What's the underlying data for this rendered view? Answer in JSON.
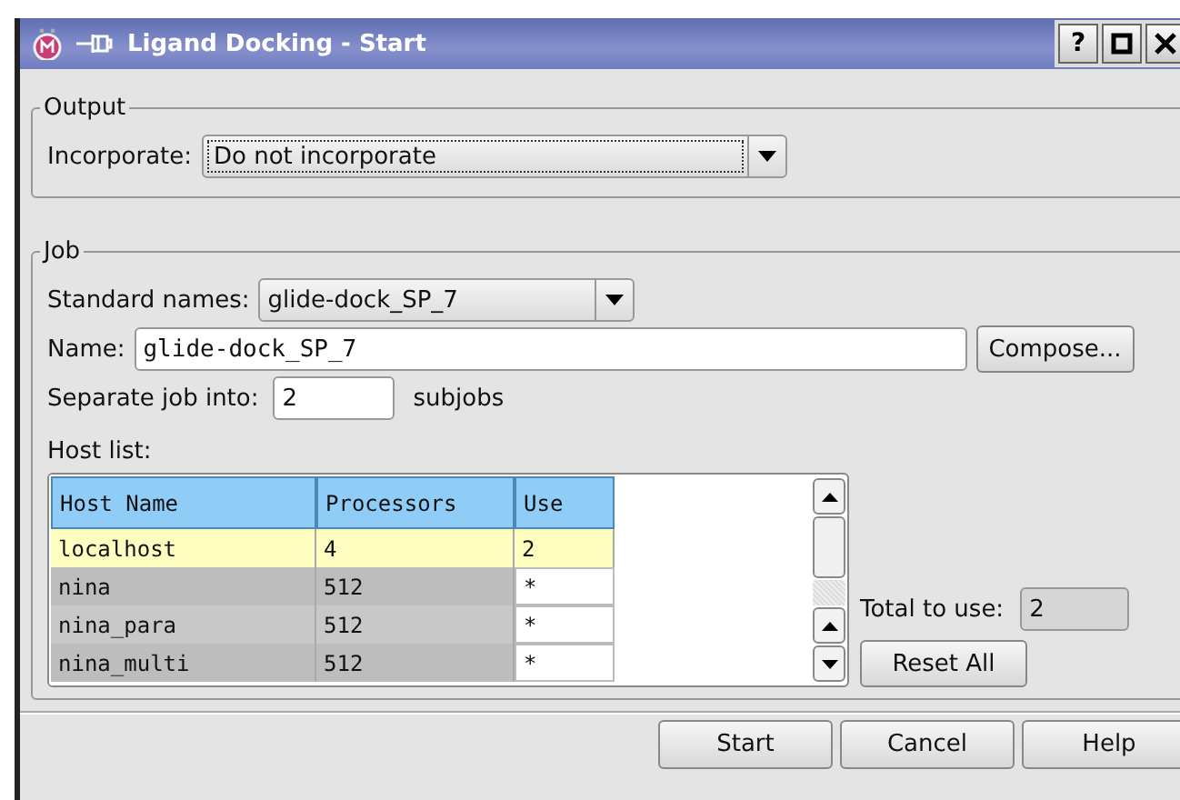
{
  "window": {
    "title": "Ligand Docking - Start",
    "help_button": "?"
  },
  "output": {
    "legend": "Output",
    "incorporate": {
      "label": "Incorporate:",
      "value": "Do not incorporate"
    }
  },
  "job": {
    "legend": "Job",
    "standard_names": {
      "label": "Standard names:",
      "value": "glide-dock_SP_7"
    },
    "name": {
      "label": "Name:",
      "value": "glide-dock_SP_7"
    },
    "compose_button": "Compose...",
    "separate": {
      "label": "Separate job into:",
      "value": "2",
      "suffix": "subjobs"
    },
    "host_list": {
      "label": "Host list:",
      "columns": [
        "Host Name",
        "Processors",
        "Use"
      ],
      "rows": [
        {
          "cells": [
            "localhost",
            "4",
            "2"
          ],
          "selected": true
        },
        {
          "cells": [
            "nina",
            "512",
            "*"
          ],
          "selected": false
        },
        {
          "cells": [
            "nina_para",
            "512",
            "*"
          ],
          "selected": false
        },
        {
          "cells": [
            "nina_multi",
            "512",
            "*"
          ],
          "selected": false
        }
      ]
    },
    "total": {
      "label": "Total to use:",
      "value": "2"
    },
    "reset_button": "Reset All"
  },
  "buttons": [
    "Start",
    "Cancel",
    "Help"
  ]
}
